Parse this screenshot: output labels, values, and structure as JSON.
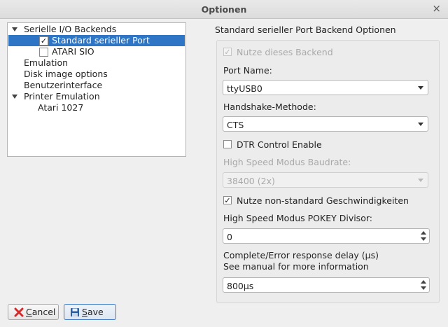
{
  "window": {
    "title": "Optionen",
    "close_glyph": "×"
  },
  "tree": {
    "items": [
      {
        "label": "Serielle I/O Backends"
      },
      {
        "label": "Standard serieller Port",
        "checked": true,
        "selected": true
      },
      {
        "label": "ATARI SIO",
        "checked": false
      },
      {
        "label": "Emulation"
      },
      {
        "label": "Disk image options"
      },
      {
        "label": "Benutzerinterface"
      },
      {
        "label": "Printer Emulation"
      },
      {
        "label": "Atari 1027"
      }
    ],
    "check_glyph": "✓"
  },
  "panel": {
    "heading": "Standard serieller Port Backend Optionen",
    "use_backend": {
      "label": "Nutze dieses Backend",
      "checked": true,
      "enabled": false
    },
    "port_name": {
      "label": "Port Name:",
      "value": "ttyUSB0"
    },
    "handshake": {
      "label": "Handshake-Methode:",
      "value": "CTS"
    },
    "dtr": {
      "label": "DTR Control Enable",
      "checked": false
    },
    "baudrate": {
      "label": "High Speed Modus Baudrate:",
      "value": "38400 (2x)",
      "enabled": false
    },
    "nonstandard": {
      "label": "Nutze non-standard Geschwindigkeiten",
      "checked": true
    },
    "pokey": {
      "label": "High Speed Modus POKEY Divisor:",
      "value": "0"
    },
    "delay": {
      "label_line1": "Complete/Error response delay (µs)",
      "label_line2": "See manual for more information",
      "value": "800µs"
    }
  },
  "buttons": {
    "cancel": {
      "underline": "C",
      "rest": "ancel"
    },
    "save": {
      "underline": "S",
      "rest": "ave"
    }
  },
  "colors": {
    "selection": "#2e75c6",
    "cancel_icon": "#d42a2a",
    "save_icon": "#2d5e9e"
  }
}
